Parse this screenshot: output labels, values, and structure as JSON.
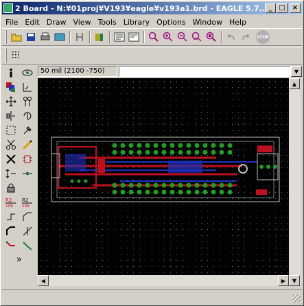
{
  "window": {
    "title": "2 Board - N:¥01proj¥V193¥eagle¥v193a1.brd - EAGLE 5.7....",
    "min_label": "_",
    "max_label": "□",
    "close_label": "×"
  },
  "menu": {
    "items": [
      "File",
      "Edit",
      "Draw",
      "View",
      "Tools",
      "Library",
      "Options",
      "Window",
      "Help"
    ]
  },
  "toolbar": {
    "stop_label": "STOP"
  },
  "command": {
    "coordinate": "50 mil (2100 -750)",
    "input_value": "",
    "dropdown_icon": "▼"
  },
  "colors": {
    "canvas_bg": "#000000",
    "grid": "#6f6f6f",
    "copper_top": "#c01020",
    "copper_bottom": "#2030c0",
    "pad": "#20a020",
    "silk": "#c0c0c0"
  },
  "scroll": {
    "up": "▲",
    "down": "▼",
    "left": "◀",
    "right": "▶"
  },
  "leftbar": {
    "more": "»"
  }
}
